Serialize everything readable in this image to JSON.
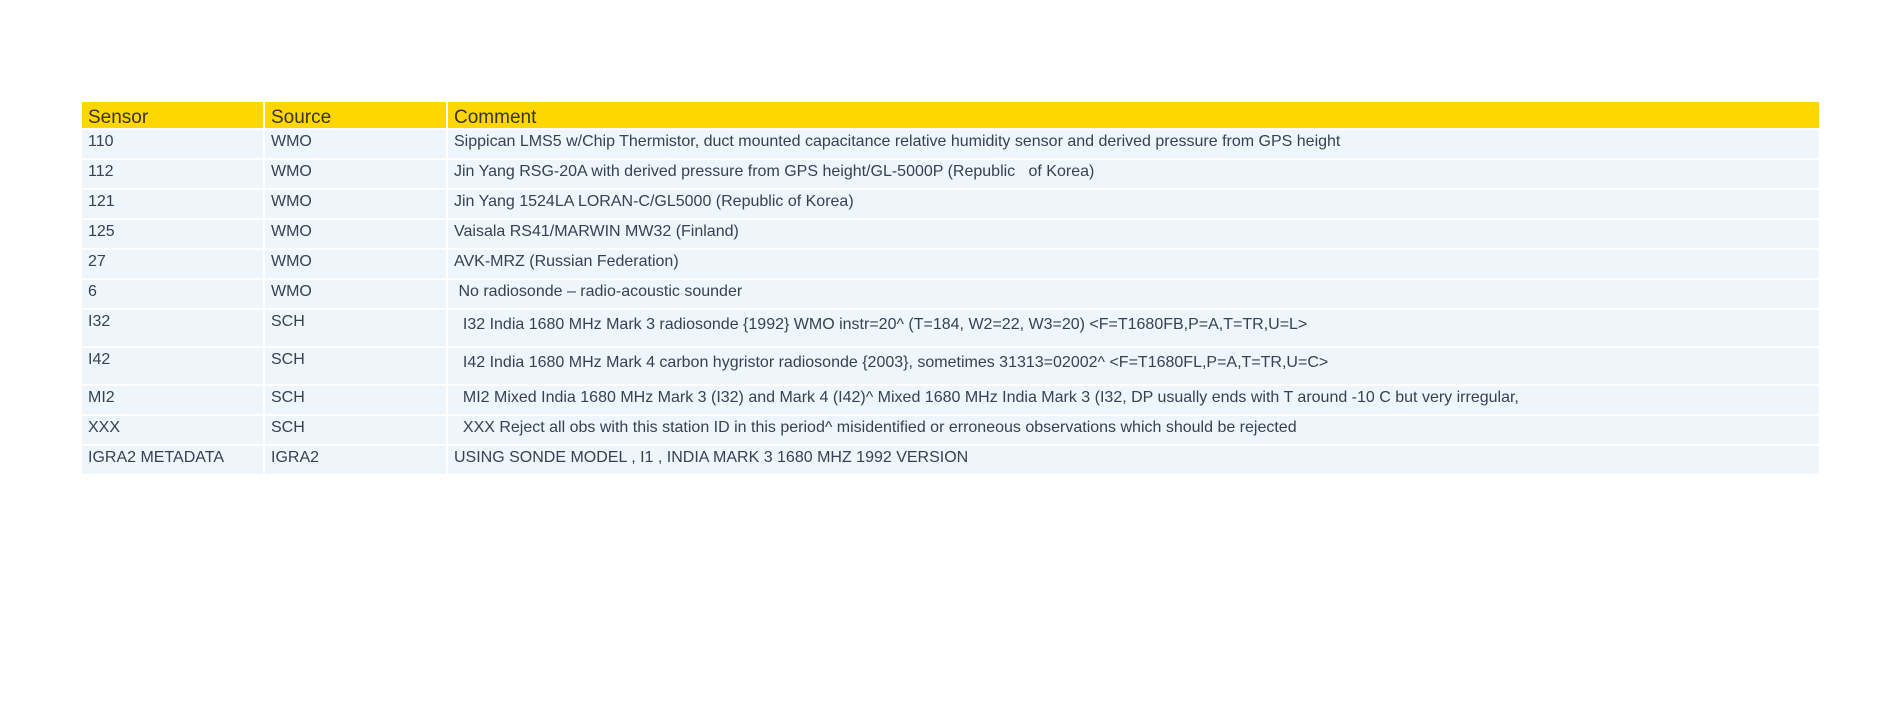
{
  "table": {
    "headers": {
      "sensor": "Sensor",
      "source": "Source",
      "comment": "Comment"
    },
    "rows": [
      {
        "sensor": "110",
        "source": "WMO",
        "comment": "Sippican LMS5 w/Chip Thermistor, duct mounted capacitance relative humidity sensor and derived pressure from GPS height"
      },
      {
        "sensor": "112",
        "source": "WMO",
        "comment": "Jin Yang RSG-20A with derived pressure from GPS height/GL-5000P (Republic   of Korea)"
      },
      {
        "sensor": "121",
        "source": "WMO",
        "comment": "Jin Yang 1524LA LORAN-C/GL5000 (Republic of Korea)"
      },
      {
        "sensor": "125",
        "source": "WMO",
        "comment": "Vaisala RS41/MARWIN MW32 (Finland)"
      },
      {
        "sensor": "27",
        "source": "WMO",
        "comment": "AVK-MRZ (Russian Federation)"
      },
      {
        "sensor": "6",
        "source": "WMO",
        "comment": " No radiosonde – radio-acoustic sounder"
      },
      {
        "sensor": "I32",
        "source": "SCH",
        "comment": "  I32 India 1680 MHz Mark 3 radiosonde {1992} WMO instr=20^ (T=184, W2=22, W3=20) <F=T1680FB,P=A,T=TR,U=L>"
      },
      {
        "sensor": "I42",
        "source": "SCH",
        "comment": "  I42 India 1680 MHz Mark 4 carbon hygristor radiosonde {2003}, sometimes 31313=02002^ <F=T1680FL,P=A,T=TR,U=C>"
      },
      {
        "sensor": "MI2",
        "source": "SCH",
        "comment": "  MI2 Mixed India 1680 MHz Mark 3 (I32) and Mark 4 (I42)^ Mixed 1680 MHz India Mark 3 (I32, DP usually ends with T around -10 C but very irregular,"
      },
      {
        "sensor": "XXX",
        "source": "SCH",
        "comment": "  XXX Reject all obs with this station ID in this period^ misidentified or erroneous observations which should be rejected"
      },
      {
        "sensor": "IGRA2 METADATA",
        "source": "IGRA2",
        "comment": "USING SONDE MODEL , I1 , INDIA MARK 3 1680 MHZ 1992 VERSION"
      }
    ]
  }
}
